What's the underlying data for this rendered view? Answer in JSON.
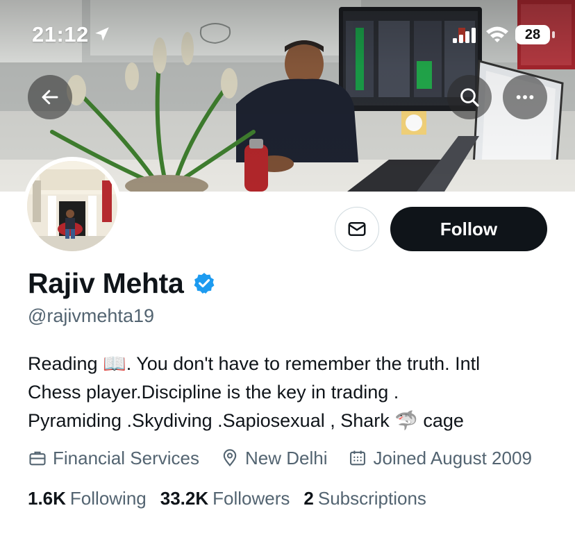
{
  "status_bar": {
    "time": "21:12",
    "battery": "28",
    "icons": [
      "location-arrow-icon",
      "cellular-signal-icon",
      "wifi-icon",
      "battery-icon"
    ]
  },
  "banner": {
    "icons": [
      "back-arrow-icon",
      "search-icon",
      "more-icon"
    ]
  },
  "profile": {
    "display_name": "Rajiv Mehta",
    "handle": "@rajivmehta19",
    "verified": true,
    "bio_lines": [
      "Reading 📖. You don't have to remember the truth. Intl",
      "Chess player.Discipline is the key in trading .",
      "Pyramiding .Skydiving .Sapiosexual , Shark 🦈 cage"
    ],
    "meta": {
      "category": "Financial Services",
      "location": "New Delhi",
      "joined": "Joined August 2009"
    },
    "stats": {
      "following_count": "1.6K",
      "following_label": "Following",
      "followers_count": "33.2K",
      "followers_label": "Followers",
      "subscriptions_count": "2",
      "subscriptions_label": "Subscriptions"
    }
  },
  "actions": {
    "follow_label": "Follow"
  },
  "colors": {
    "primary_text": "#0f1419",
    "secondary_text": "#536471",
    "verified_blue": "#1d9bf0",
    "follow_bg": "#0f1419",
    "border": "#cfd9de"
  }
}
